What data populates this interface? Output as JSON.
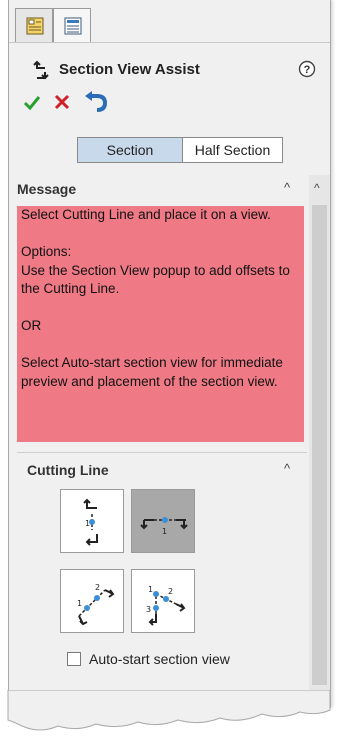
{
  "panel": {
    "title": "Section View Assist",
    "icons": {
      "tab1": "property-manager-icon",
      "tab2": "feature-tree-icon",
      "title": "section-view-icon",
      "help": "help-icon",
      "ok": "checkmark-icon",
      "cancel": "close-icon",
      "back": "undo-arrow-icon"
    }
  },
  "mode_toggle": {
    "section": "Section",
    "half_section": "Half Section",
    "selected": "Section"
  },
  "message_group": {
    "label": "Message",
    "lines": [
      "Select Cutting Line and place it on a view.",
      "",
      "Options:",
      "Use the Section View popup to add offsets to the Cutting Line.",
      "",
      "OR",
      "",
      "Select Auto-start section view for immediate preview and placement of the section view."
    ],
    "background": "#ef7a86"
  },
  "cutting_line_group": {
    "label": "Cutting Line",
    "buttons": [
      {
        "name": "vertical-cutting-line-icon",
        "selected": false
      },
      {
        "name": "horizontal-cutting-line-icon",
        "selected": true
      },
      {
        "name": "auxiliary-cutting-line-icon",
        "selected": false
      },
      {
        "name": "aligned-cutting-line-icon",
        "selected": false
      }
    ],
    "auto_start_label": "Auto-start section view",
    "auto_start_checked": false
  },
  "colors": {
    "ok": "#2aa033",
    "cancel": "#d11f2a",
    "back": "#2b6cb8",
    "selected_toggle": "#c9d9ec"
  }
}
